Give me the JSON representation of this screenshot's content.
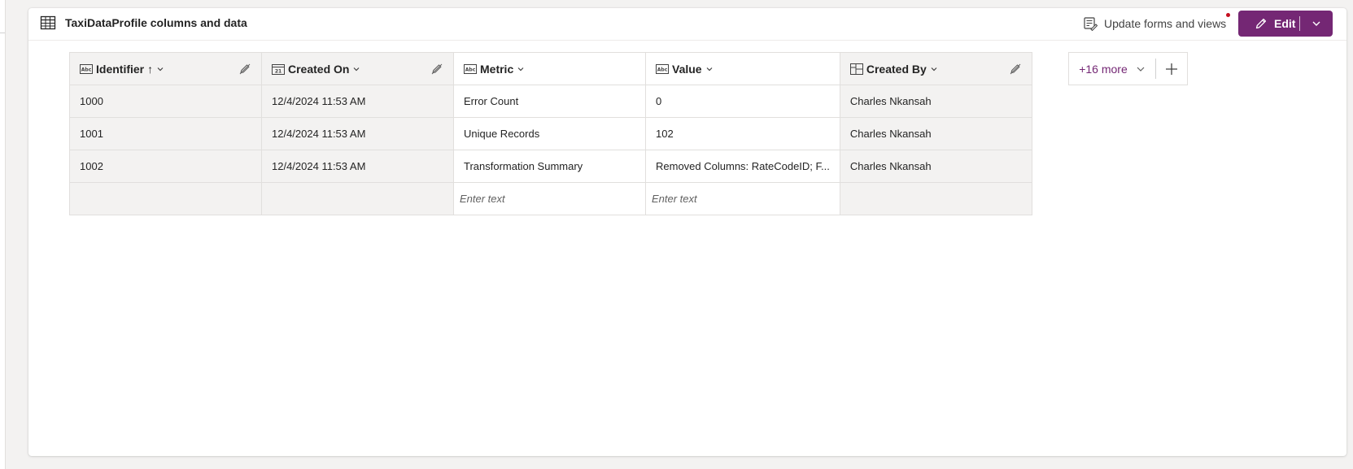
{
  "header": {
    "title": "TaxiDataProfile columns and data",
    "update_forms_label": "Update forms and views",
    "edit_label": "Edit"
  },
  "columns": [
    {
      "label": "Identifier",
      "sort_indicator": "↑",
      "type_icon": "text-type-icon",
      "read_only": true
    },
    {
      "label": "Created On",
      "type_icon": "calendar-icon",
      "read_only": true
    },
    {
      "label": "Metric",
      "type_icon": "text-type-icon",
      "read_only": false
    },
    {
      "label": "Value",
      "type_icon": "text-type-icon",
      "read_only": false
    },
    {
      "label": "Created By",
      "type_icon": "lookup-icon",
      "read_only": true
    }
  ],
  "rows": [
    [
      "1000",
      "12/4/2024 11:53 AM",
      "Error Count",
      "0",
      "Charles Nkansah"
    ],
    [
      "1001",
      "12/4/2024 11:53 AM",
      "Unique Records",
      "102",
      "Charles Nkansah"
    ],
    [
      "1002",
      "12/4/2024 11:53 AM",
      "Transformation Summary",
      "Removed Columns: RateCodeID; F...",
      "Charles Nkansah"
    ]
  ],
  "new_row": {
    "metric_placeholder": "Enter text",
    "value_placeholder": "Enter text"
  },
  "more_columns_label": "+16 more",
  "colors": {
    "accent": "#742774",
    "notification": "#c50f1f",
    "readonly_bg": "#f3f2f1"
  }
}
